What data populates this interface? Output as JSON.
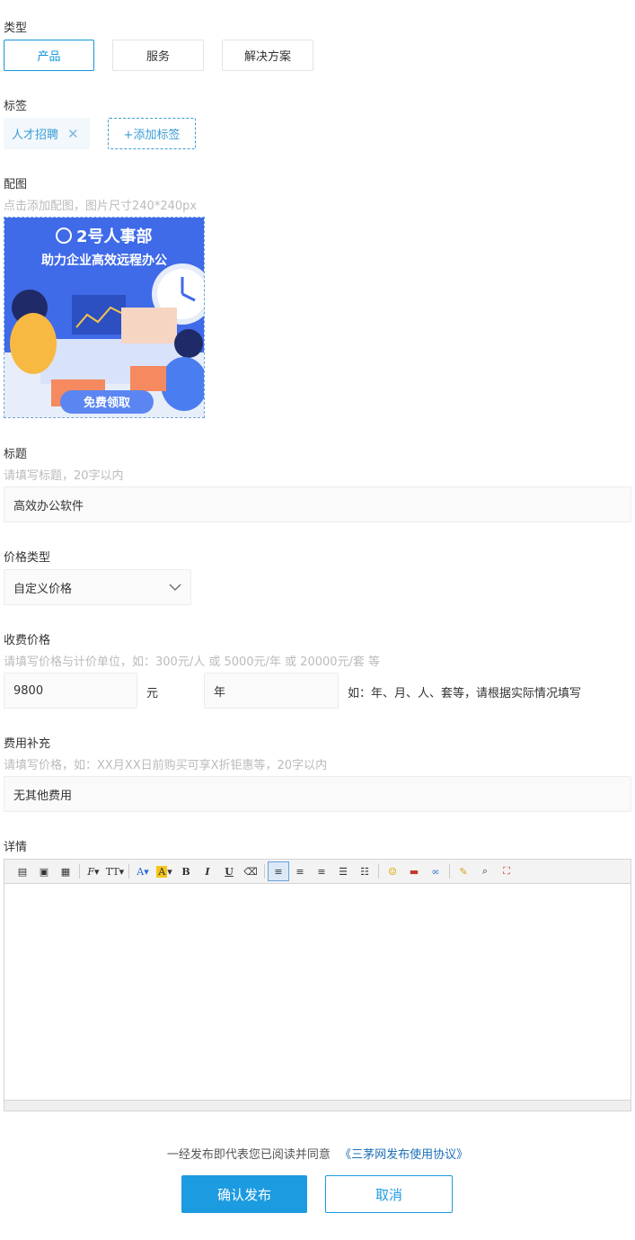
{
  "type_section": {
    "label": "类型",
    "options": [
      "产品",
      "服务",
      "解决方案"
    ],
    "selected": "产品"
  },
  "tag_section": {
    "label": "标签",
    "tags": [
      {
        "text": "人才招聘"
      }
    ],
    "add_label": "+添加标签"
  },
  "image_section": {
    "label": "配图",
    "hint": "点击添加配图，图片尺寸240*240px",
    "image": {
      "brand": "2号人事部",
      "headline": "助力企业高效远程办公",
      "cta": "免费领取"
    }
  },
  "title_section": {
    "label": "标题",
    "hint": "请填写标题，20字以内",
    "value": "高效办公软件"
  },
  "price_type_section": {
    "label": "价格类型",
    "selected": "自定义价格"
  },
  "price_section": {
    "label": "收费价格",
    "hint": "请填写价格与计价单位，如：300元/人 或 5000元/年 或 20000元/套 等",
    "amount": "9800",
    "currency": "元",
    "unit": "年",
    "unit_hint": "如：年、月、人、套等，请根据实际情况填写"
  },
  "fee_section": {
    "label": "费用补充",
    "hint": "请填写价格，如：XX月XX日前购买可享X折钜惠等，20字以内",
    "value": "无其他费用"
  },
  "detail_section": {
    "label": "详情",
    "content": ""
  },
  "footer": {
    "agreement_prefix": "一经发布即代表您已阅读并同意",
    "agreement_link": "《三茅网发布使用协议》",
    "submit_label": "确认发布",
    "cancel_label": "取消"
  },
  "colors": {
    "accent": "#1d9be0",
    "tag_bg": "#f2f8fc",
    "banner_bg": "#3f6ae8"
  }
}
